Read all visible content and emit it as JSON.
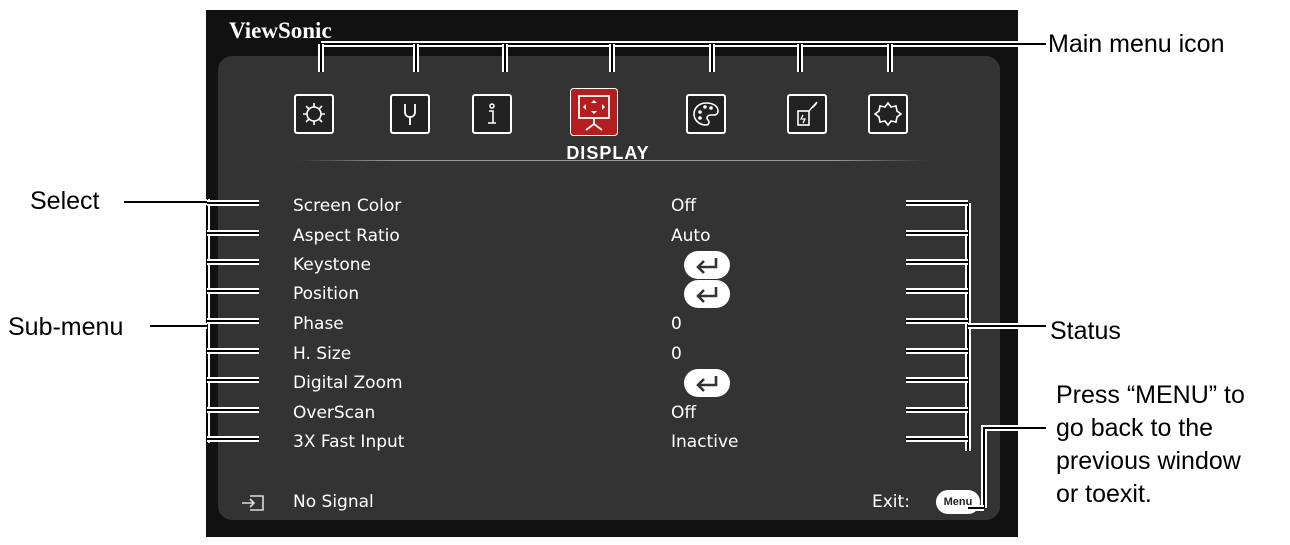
{
  "osd": {
    "brand": "ViewSonic",
    "category_icons": [
      {
        "name": "picture-settings-icon",
        "selected": false
      },
      {
        "name": "wrench-icon",
        "selected": false
      },
      {
        "name": "info-icon",
        "selected": false
      },
      {
        "name": "display-icon",
        "selected": true
      },
      {
        "name": "palette-icon",
        "selected": false
      },
      {
        "name": "power-settings-icon",
        "selected": false
      },
      {
        "name": "gear-icon",
        "selected": false
      }
    ],
    "active_category": "DISPLAY",
    "menu_items": [
      {
        "label": "Screen Color",
        "value": "Off"
      },
      {
        "label": "Aspect Ratio",
        "value": "Auto"
      },
      {
        "label": "Keystone",
        "value": "",
        "icon": "enter-icon"
      },
      {
        "label": "Position",
        "value": "",
        "icon": "enter-icon"
      },
      {
        "label": "Phase",
        "value": "0"
      },
      {
        "label": "H. Size",
        "value": "0"
      },
      {
        "label": "Digital Zoom",
        "value": "",
        "icon": "enter-icon"
      },
      {
        "label": "OverScan",
        "value": "Off"
      },
      {
        "label": "3X Fast Input",
        "value": "Inactive"
      }
    ],
    "signal_status": "No Signal",
    "exit_label": "Exit:",
    "menu_button_label": "Menu",
    "colors": {
      "frame": "#111111",
      "panel": "#333333",
      "selected_icon": "#b41e1e",
      "text": "#ffffff"
    }
  },
  "callouts": {
    "main_menu_icon": "Main menu icon",
    "select": "Select",
    "sub_menu": "Sub-menu",
    "status": "Status",
    "press_menu": [
      "Press “MENU” to",
      "go back to the",
      "previous window",
      "or toexit."
    ]
  }
}
